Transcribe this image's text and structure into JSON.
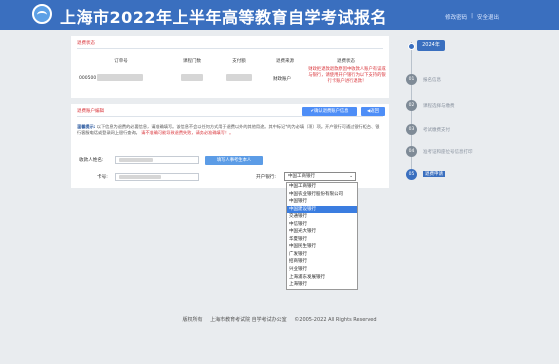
{
  "header": {
    "title": "上海市2022年上半年高等教育自学考试报名",
    "links": [
      "修改密码",
      "|",
      "安全退出"
    ]
  },
  "refund_status": {
    "section_title": "退费状态",
    "columns": [
      "订单号",
      "课程门数",
      "支付额",
      "退费来源",
      "退费状态"
    ],
    "row": {
      "order_no": "000500",
      "source": "财政账户",
      "status": "财政拒退款退款原因中收款人账户有误或与银行，请使用开户银行为以下支持的银行卡账户进行退款！"
    }
  },
  "refund_account": {
    "section_title": "退费账户编辑",
    "confirm_button": "✔确认退费账户信息",
    "back_button": "◀返回",
    "tip_label": "温馨提示:",
    "tip_text": "以下信息为退费的必要信息，请准确填写。该信息不会以任何方式用于退费以外的其他用途。其中标记*的为必填（项）项。开户银行可通过银行柜台、银行客服电话或登录网上银行查询。",
    "tip_warning": "请不准确可能导致退费失败，请务必准确填写！。",
    "payee_label": "收款人姓名:",
    "fill_button": "填写人事考生本人",
    "card_label": "卡号:",
    "bank_label": "开户银行:",
    "bank_selected": "中国工商银行"
  },
  "bank_options": [
    "中国工商银行",
    "中国农业银行股份有限公司",
    "中国银行",
    "中国建设银行",
    "交通银行",
    "中信银行",
    "中国光大银行",
    "华夏银行",
    "中国民生银行",
    "广发银行",
    "招商银行",
    "兴业银行",
    "上海浦东发展银行",
    "上海银行"
  ],
  "steps": {
    "year": "2024年",
    "items": [
      {
        "num": "01",
        "label": "报名信息"
      },
      {
        "num": "02",
        "label": "课程选择与缴费"
      },
      {
        "num": "03",
        "label": "考试缴费支付"
      },
      {
        "num": "04",
        "label": "准考证和座位号信息打印"
      },
      {
        "num": "05",
        "label": "退费申请"
      }
    ]
  },
  "footer": {
    "copyright": "版权所有",
    "org": "上海市教育考试院 自学考试办公室",
    "years": "©2005-2022 All Rights Reserved"
  }
}
